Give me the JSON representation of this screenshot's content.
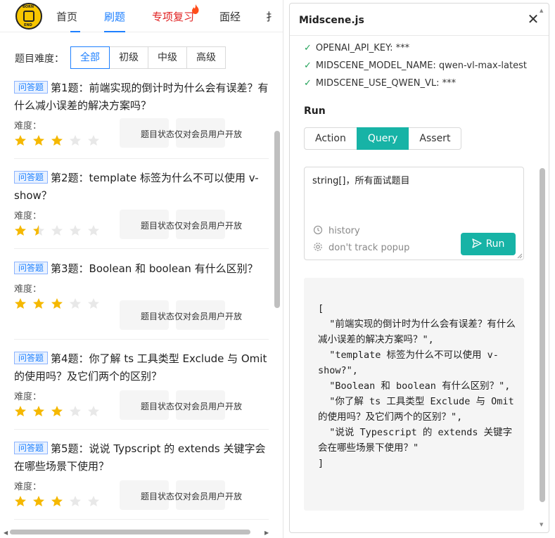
{
  "nav": {
    "logo_top": "BORN",
    "logo_bottom": "END",
    "items": [
      "首页",
      "刷题",
      "专项复习",
      "面经",
      "扌"
    ]
  },
  "filter": {
    "label": "题目难度：",
    "options": [
      "全部",
      "初级",
      "中级",
      "高级"
    ]
  },
  "questions": [
    {
      "tag": "问答题",
      "title": "第1题：前端实现的倒计时为什么会有误差？有什么减小误差的解决方案吗？",
      "difficulty_label": "难度：",
      "stars": 3,
      "member_note": "题目状态仅对会员用户开放"
    },
    {
      "tag": "问答题",
      "title": "第2题：template 标签为什么不可以使用 v-show？",
      "difficulty_label": "难度：",
      "stars": 1.5,
      "member_note": "题目状态仅对会员用户开放"
    },
    {
      "tag": "问答题",
      "title": "第3题：Boolean 和 boolean 有什么区别？",
      "difficulty_label": "难度：",
      "stars": 3,
      "member_note": "题目状态仅对会员用户开放"
    },
    {
      "tag": "问答题",
      "title": "第4题：你了解 ts 工具类型 Exclude 与 Omit 的使用吗？及它们两个的区别？",
      "difficulty_label": "难度：",
      "stars": 3,
      "member_note": "题目状态仅对会员用户开放"
    },
    {
      "tag": "问答题",
      "title": "第5题：说说 Typscript 的 extends 关键字会在哪些场景下使用？",
      "difficulty_label": "难度：",
      "stars": 3,
      "member_note": "题目状态仅对会员用户开放"
    }
  ],
  "panel": {
    "title": "Midscene.js",
    "env": [
      "OPENAI_API_KEY: ***",
      "MIDSCENE_MODEL_NAME: qwen-vl-max-latest",
      "MIDSCENE_USE_QWEN_VL: ***"
    ],
    "run_heading": "Run",
    "modes": [
      "Action",
      "Query",
      "Assert"
    ],
    "active_mode": "Query",
    "prompt": "string[]，所有面试题目",
    "history_label": "history",
    "track_label": "don't track popup",
    "run_label": "Run",
    "result": "[\n  \"前端实现的倒计时为什么会有误差？有什么减小误差的解决方案吗？\",\n  \"template 标签为什么不可以使用 v-show?\",\n  \"Boolean 和 boolean 有什么区别？\",\n  \"你了解 ts 工具类型 Exclude 与 Omit 的使用吗？及它们两个的区别？\",\n  \"说说 Typescript 的 extends 关键字会在哪些场景下使用？\"\n]"
  },
  "colors": {
    "accent_blue": "#1e80ff",
    "accent_teal": "#17b3a6",
    "star_gold": "#f5b800",
    "check_green": "#23a35a"
  }
}
